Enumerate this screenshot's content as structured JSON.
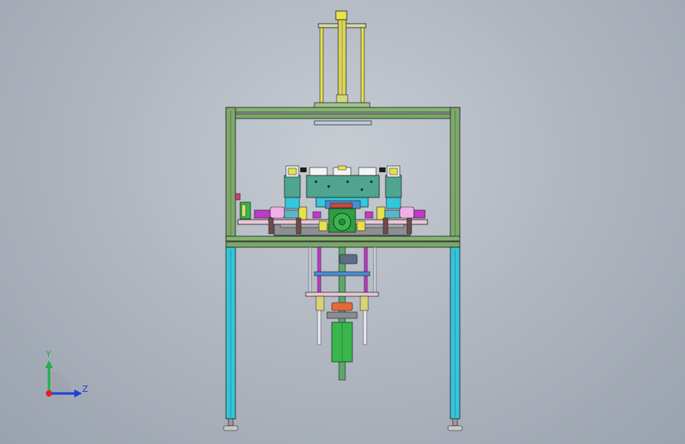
{
  "triad": {
    "y_label": "Y",
    "z_label": "Z",
    "y_color": "#22b14c",
    "z_color": "#1f3fd6",
    "x_color": "#e0202a"
  },
  "colors": {
    "frame_green": "#7fa96a",
    "leg_cyan": "#35c6dc",
    "cylinder_yellow": "#e8e24a",
    "block_teal": "#4fa58e",
    "motor_green": "#39b74d",
    "accent_magenta": "#c03ac8",
    "plate_pink": "#e6c8d6",
    "outline": "#1c1c1c"
  }
}
